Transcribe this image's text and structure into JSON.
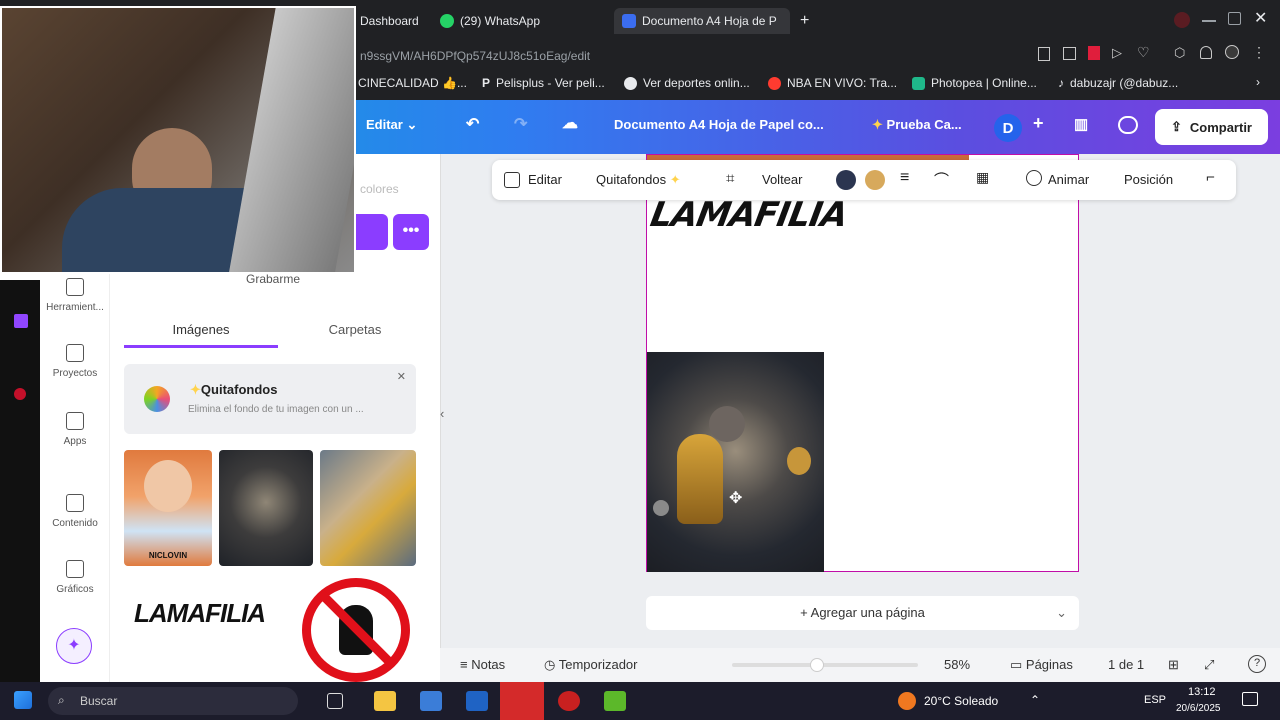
{
  "browser": {
    "tabs": [
      {
        "label": "Dashboard",
        "active": false
      },
      {
        "label": "(29) WhatsApp",
        "active": false
      },
      {
        "label": "Documento A4 Hoja de P",
        "active": true
      }
    ],
    "new_tab": "+",
    "url": "n9ssgVM/AH6DPfQp574zUJ8c51oEag/edit"
  },
  "bookmarks": [
    {
      "label": "CINECALIDAD 👍...",
      "color": "#f5c518"
    },
    {
      "label": "Pelisplus - Ver peli...",
      "color": "#ffffff"
    },
    {
      "label": "Ver deportes onlin...",
      "color": "#e8eaed"
    },
    {
      "label": "NBA EN VIVO: Tra...",
      "color": "#ff3b30"
    },
    {
      "label": "Photopea | Online...",
      "color": "#1fb88a"
    },
    {
      "label": "dabuzajr (@dabuz...",
      "color": "#ffffff"
    }
  ],
  "canva": {
    "edit_menu": "Editar",
    "doc_title": "Documento A4 Hoja de Papel co...",
    "trial": "Prueba Ca...",
    "avatar": "D",
    "share": "Compartir"
  },
  "toolbar": {
    "edit": "Editar",
    "bgremover": "Quitafondos",
    "flip": "Voltear",
    "animate": "Animar",
    "position": "Posición"
  },
  "side_panel": {
    "partial_top": "Grabarme",
    "partial_colors": "colores",
    "tabs": [
      {
        "label": "Imágenes",
        "active": true
      },
      {
        "label": "Carpetas",
        "active": false
      }
    ],
    "promo_title": "Quitafondos",
    "promo_desc": "Elimina el fondo de tu imagen con un ...",
    "thumb_text": "LAMAFILIA",
    "sticker_caption": "NICLOVIN"
  },
  "nav": [
    {
      "label": "Herramient..."
    },
    {
      "label": "Proyectos"
    },
    {
      "label": "Apps"
    },
    {
      "label": "Contenido"
    },
    {
      "label": "Gráficos"
    }
  ],
  "canvas": {
    "logo_text": "LAMAFILIA",
    "add_page": "+ Agregar una página"
  },
  "footer": {
    "notes": "Notas",
    "timer": "Temporizador",
    "zoom": "58%",
    "pages": "Páginas",
    "page_count": "1 de 1"
  },
  "taskbar": {
    "search": "Buscar",
    "weather": "20°C  Soleado",
    "lang": "ESP",
    "time": "13:12",
    "date": "20/6/2025"
  }
}
